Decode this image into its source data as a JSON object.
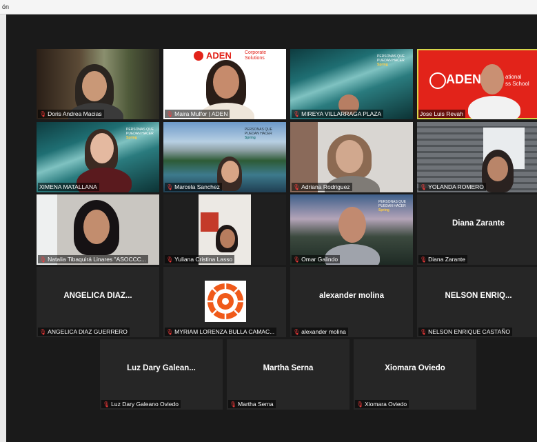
{
  "window": {
    "title": "ón"
  },
  "brand": {
    "aden": "ADEN",
    "corporate": "Corporate",
    "solutions": "Solutions",
    "tagline_1": "ational",
    "tagline_2": "ss School",
    "spring_1": "PERSONAS QUE",
    "spring_2": "PUEDAN HACER",
    "spring_3": "Spring"
  },
  "participants": [
    {
      "name": "Doris Andrea Macias",
      "big": ""
    },
    {
      "name": "Maira Mulfor | ADEN",
      "big": ""
    },
    {
      "name": "MIREYA VILLARRAGA PLAZA",
      "big": ""
    },
    {
      "name": "Jose Luis Revah",
      "big": ""
    },
    {
      "name": "XIMENA MATALLANA",
      "big": ""
    },
    {
      "name": "Marcela Sanchez",
      "big": ""
    },
    {
      "name": "Adriana Rodriguez",
      "big": ""
    },
    {
      "name": "YOLANDA ROMERO",
      "big": ""
    },
    {
      "name": "Natalia Tibaquirá Linares \"ASOCCC...",
      "big": ""
    },
    {
      "name": "Yuliana Cristina Lasso",
      "big": ""
    },
    {
      "name": "Omar Galindo",
      "big": ""
    },
    {
      "name": "Diana Zarante",
      "big": "Diana Zarante"
    },
    {
      "name": "ANGELICA DIAZ GUERRERO",
      "big": "ANGELICA  DIAZ..."
    },
    {
      "name": "MYRIAM LORENZA BULLA CAMAC...",
      "big": ""
    },
    {
      "name": "alexander molina",
      "big": "alexander molina"
    },
    {
      "name": "NELSON ENRIQUE CASTAÑO",
      "big": "NELSON  ENRIQ..."
    },
    {
      "name": "Luz Dary Galeano Oviedo",
      "big": "Luz  Dary  Galean..."
    },
    {
      "name": "Martha Serna",
      "big": "Martha Serna"
    },
    {
      "name": "Xiomara Oviedo",
      "big": "Xiomara Oviedo"
    }
  ],
  "icons": {
    "muted_mic": "muted-mic-icon"
  },
  "colors": {
    "active_speaker_border": "#d6d64a",
    "aden_red": "#e2231a",
    "muted": "#ff3b3b"
  }
}
